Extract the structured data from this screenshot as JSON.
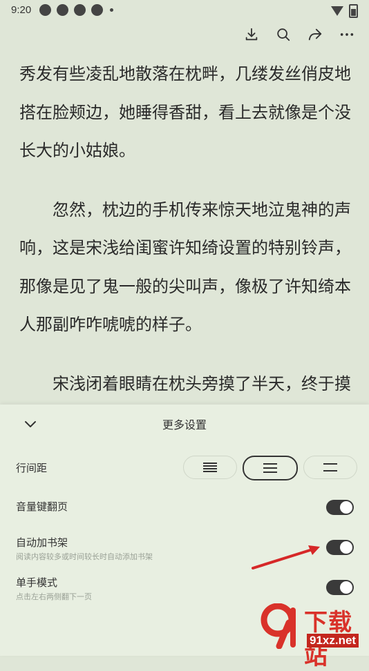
{
  "status_bar": {
    "time": "9:20",
    "notification_icons": [
      "app-notification-icon",
      "app-notification-icon",
      "sync-icon",
      "sync-icon"
    ],
    "right_icons": [
      "wifi-icon",
      "battery-icon"
    ]
  },
  "toolbar": {
    "icons": [
      "download-icon",
      "search-icon",
      "share-icon",
      "more-icon"
    ]
  },
  "reader": {
    "paragraphs": [
      "秀发有些凌乱地散落在枕畔，几缕发丝俏皮地搭在脸颊边，她睡得香甜，看上去就像是个没长大的小姑娘。",
      "忽然，枕边的手机传来惊天地泣鬼神的声响，这是宋浅给闺蜜许知绮设置的特别铃声，那像是见了鬼一般的尖叫声，像极了许知绮本人那副咋咋唬唬的样子。",
      "宋浅闭着眼睛在枕头旁摸了半天，终于摸到了手机，声音慵懒：“喂？”"
    ]
  },
  "settings_panel": {
    "title": "更多设置",
    "line_spacing": {
      "label": "行间距",
      "options": [
        "compact",
        "medium",
        "loose"
      ],
      "selected": "medium"
    },
    "volume_key_page": {
      "label": "音量键翻页",
      "enabled": true
    },
    "auto_add_shelf": {
      "label": "自动加书架",
      "description": "阅读内容较多或时间较长时自动添加书架",
      "enabled": true
    },
    "one_hand_mode": {
      "label": "单手模式",
      "description": "点击左右两侧翻下一页",
      "enabled": true
    }
  },
  "watermark": {
    "brand_text": "下载站",
    "url_text": "91xz.net"
  },
  "colors": {
    "background": "#dfe6d7",
    "panel": "#e8efe1",
    "toggle_on": "#3a3a3a",
    "annotation_arrow": "#d62828"
  }
}
